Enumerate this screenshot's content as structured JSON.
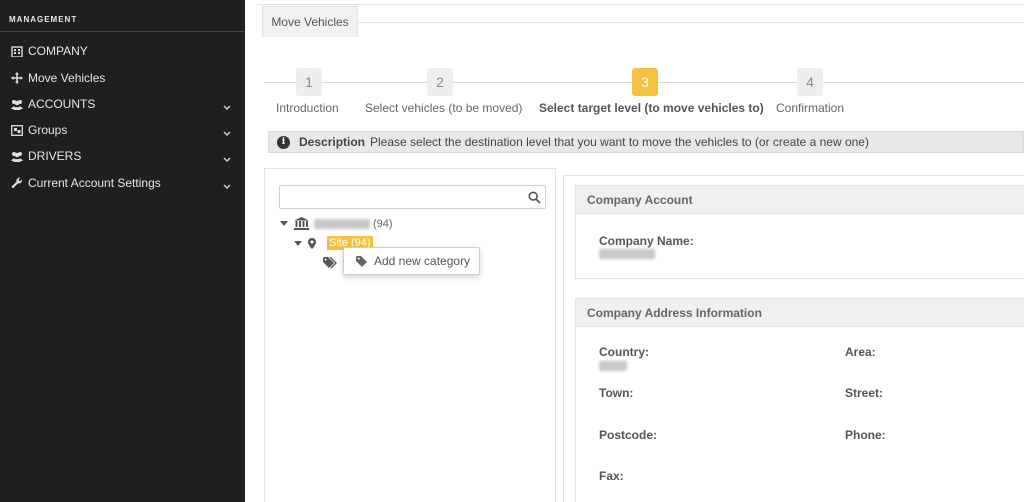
{
  "sidebar": {
    "header": "MANAGEMENT",
    "items": [
      {
        "label": "COMPANY",
        "icon": "building-icon",
        "expandable": false
      },
      {
        "label": "Move Vehicles",
        "icon": "move-arrows-icon",
        "expandable": false
      },
      {
        "label": "ACCOUNTS",
        "icon": "users-icon",
        "expandable": true
      },
      {
        "label": "Groups",
        "icon": "group-box-icon",
        "expandable": true
      },
      {
        "label": "DRIVERS",
        "icon": "users-icon",
        "expandable": true
      },
      {
        "label": "Current Account Settings",
        "icon": "wrench-icon",
        "expandable": true
      }
    ]
  },
  "tab": {
    "label": "Move Vehicles"
  },
  "wizard": {
    "steps": [
      {
        "number": "1",
        "label": "Introduction",
        "active": false
      },
      {
        "number": "2",
        "label": "Select vehicles (to be moved)",
        "active": false
      },
      {
        "number": "3",
        "label": "Select target level (to move vehicles to)",
        "active": true
      },
      {
        "number": "4",
        "label": "Confirmation",
        "active": false
      }
    ],
    "active_color": "#f5c142"
  },
  "description": {
    "title": "Description",
    "text": "Please select the destination level that you want to move the vehicles to (or create a new one)"
  },
  "tree": {
    "search_placeholder": "",
    "root_count": "(94)",
    "site_label": "Site (94)",
    "context_menu_item": "Add new category"
  },
  "company_account": {
    "title": "Company Account",
    "name_label": "Company Name:"
  },
  "address": {
    "title": "Company Address Information",
    "country_label": "Country:",
    "area_label": "Area:",
    "town_label": "Town:",
    "street_label": "Street:",
    "postcode_label": "Postcode:",
    "phone_label": "Phone:",
    "fax_label": "Fax:"
  }
}
